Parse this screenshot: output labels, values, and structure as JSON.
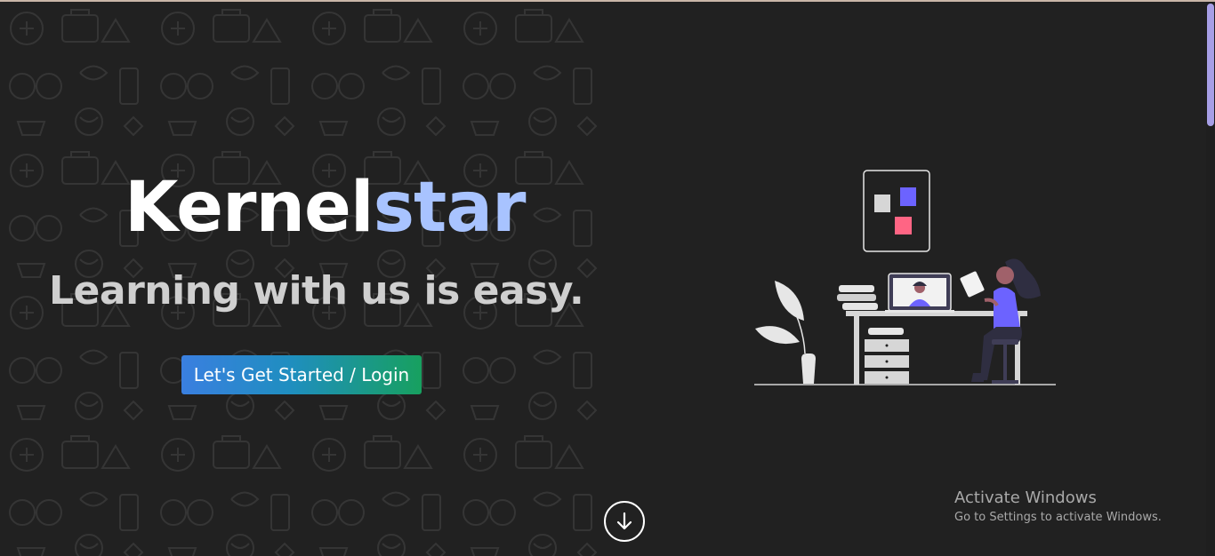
{
  "hero": {
    "brand_part1": "Kernel",
    "brand_part2": "star",
    "tagline": "Learning with us is easy.",
    "cta_label": "Let's Get Started / Login"
  },
  "scroll_down": {
    "icon": "arrow-down-circle-icon"
  },
  "watermark": {
    "title": "Activate Windows",
    "subtitle": "Go to Settings to activate Windows."
  },
  "colors": {
    "background": "#212121",
    "brand_accent": "#a8c3ff",
    "cta_gradient_start": "#3a7fe0",
    "cta_gradient_end": "#17a05f",
    "illustration_purple": "#6c63ff",
    "illustration_pink": "#ff6584",
    "scrollbar_thumb": "#a79fe6"
  },
  "scrollbar": {
    "position_fraction": 0.0
  }
}
